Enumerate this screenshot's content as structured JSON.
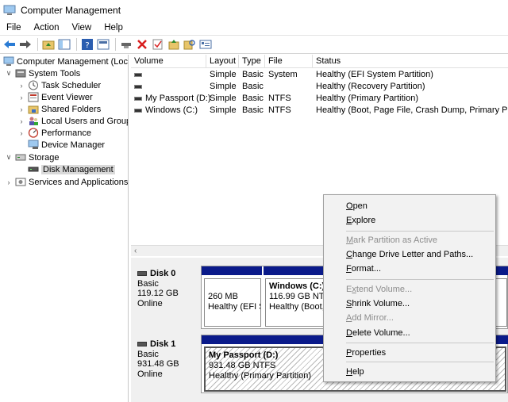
{
  "window": {
    "title": "Computer Management"
  },
  "menu": [
    "File",
    "Action",
    "View",
    "Help"
  ],
  "toolbar_icons": [
    "back-arrow-icon",
    "forward-arrow-icon",
    "up-folder-icon",
    "show-hide-tree-icon",
    "help-icon",
    "console-icon",
    "connect-icon",
    "delete-icon",
    "check-icon",
    "import-icon",
    "search-icon",
    "properties-icon"
  ],
  "tree": {
    "root": "Computer Management (Local",
    "system_tools": "System Tools",
    "task_scheduler": "Task Scheduler",
    "event_viewer": "Event Viewer",
    "shared_folders": "Shared Folders",
    "local_users": "Local Users and Groups",
    "performance": "Performance",
    "device_manager": "Device Manager",
    "storage": "Storage",
    "disk_management": "Disk Management",
    "services_apps": "Services and Applications"
  },
  "volume_list": {
    "headers": [
      "Volume",
      "Layout",
      "Type",
      "File System",
      "Status"
    ],
    "rows": [
      {
        "volume": "",
        "layout": "Simple",
        "type": "Basic",
        "fs": "",
        "status": "Healthy (EFI System Partition)"
      },
      {
        "volume": "",
        "layout": "Simple",
        "type": "Basic",
        "fs": "",
        "status": "Healthy (Recovery Partition)"
      },
      {
        "volume": "My Passport (D:)",
        "layout": "Simple",
        "type": "Basic",
        "fs": "NTFS",
        "status": "Healthy (Primary Partition)"
      },
      {
        "volume": "Windows (C:)",
        "layout": "Simple",
        "type": "Basic",
        "fs": "NTFS",
        "status": "Healthy (Boot, Page File, Crash Dump, Primary Partitio"
      }
    ]
  },
  "disks": [
    {
      "name": "Disk 0",
      "type": "Basic",
      "size": "119.12 GB",
      "status": "Online",
      "partitions": [
        {
          "name": "",
          "size": "260 MB",
          "status": "Healthy (EFI Sy"
        },
        {
          "name": "Windows  (C:)",
          "size": "116.99 GB NTFS",
          "status": "Healthy (Boot,"
        }
      ]
    },
    {
      "name": "Disk 1",
      "type": "Basic",
      "size": "931.48 GB",
      "status": "Online",
      "partitions": [
        {
          "name": "My Passport  (D:)",
          "size": "931.48 GB NTFS",
          "status": "Healthy (Primary Partition)"
        }
      ]
    }
  ],
  "context_menu": {
    "open": {
      "pre": "",
      "u": "O",
      "post": "pen"
    },
    "explore": {
      "pre": "",
      "u": "E",
      "post": "xplore"
    },
    "mark_active": {
      "pre": "",
      "u": "M",
      "post": "ark Partition as Active"
    },
    "change_letter": {
      "pre": "",
      "u": "C",
      "post": "hange Drive Letter and Paths..."
    },
    "format": {
      "pre": "",
      "u": "F",
      "post": "ormat..."
    },
    "extend": {
      "pre": "E",
      "u": "x",
      "post": "tend Volume..."
    },
    "shrink": {
      "pre": "",
      "u": "S",
      "post": "hrink Volume..."
    },
    "add_mirror": {
      "pre": "",
      "u": "A",
      "post": "dd Mirror..."
    },
    "delete": {
      "pre": "",
      "u": "D",
      "post": "elete Volume..."
    },
    "properties": {
      "pre": "",
      "u": "P",
      "post": "roperties"
    },
    "help": {
      "pre": "",
      "u": "H",
      "post": "elp"
    }
  }
}
